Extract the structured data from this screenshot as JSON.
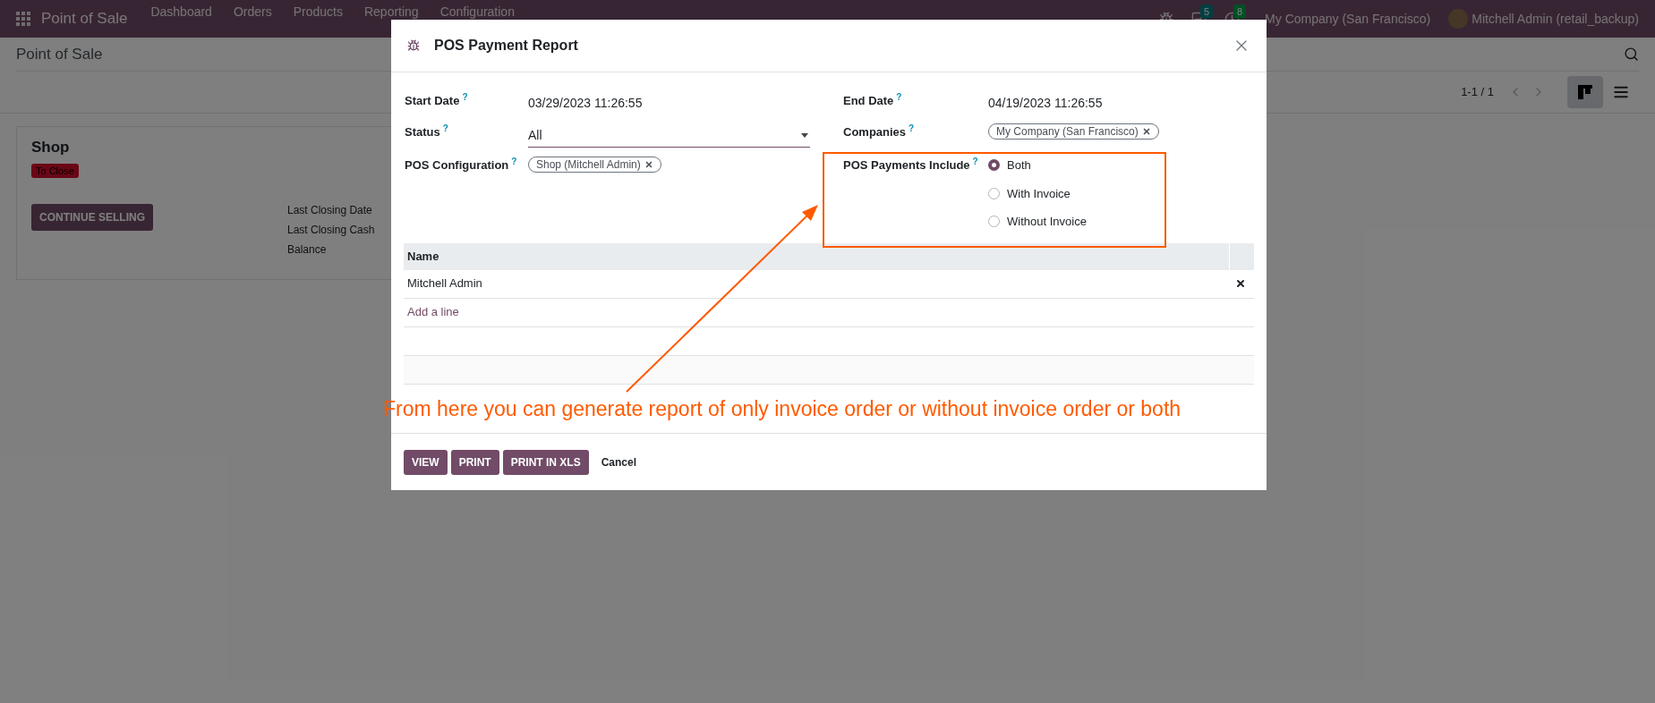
{
  "navbar": {
    "app_name": "Point of Sale",
    "menu": [
      "Dashboard",
      "Orders",
      "Products",
      "Reporting",
      "Configuration"
    ],
    "messages_badge": "5",
    "activities_badge": "8",
    "company": "My Company (San Francisco)",
    "user": "Mitchell Admin (retail_backup)"
  },
  "control_panel": {
    "breadcrumb": "Point of Sale",
    "pager": "1-1 / 1",
    "views": [
      {
        "kind": "kanban",
        "selected": true
      },
      {
        "kind": "list",
        "selected": false
      }
    ]
  },
  "card": {
    "title": "Shop",
    "badge": "To Close",
    "button": "CONTINUE SELLING",
    "info": [
      "Last Closing Date",
      "Last Closing Cash",
      "Balance"
    ]
  },
  "dialog": {
    "title": "POS Payment Report",
    "rows": [
      [
        {
          "label": "Start Date",
          "help": "?",
          "kind": "text",
          "value": "03/29/2023 11:26:55"
        },
        {
          "label": "End Date",
          "help": "?",
          "kind": "text",
          "value": "04/19/2023 11:26:55"
        }
      ],
      [
        {
          "label": "Status",
          "help": "?",
          "kind": "select",
          "value": "All"
        },
        {
          "label": "Companies",
          "help": "?",
          "kind": "tags",
          "tags": [
            "My Company (San Francisco)"
          ]
        }
      ],
      [
        {
          "label": "POS Configuration",
          "help": "?",
          "kind": "tags",
          "tags": [
            "Shop (Mitchell Admin)"
          ]
        },
        {
          "label": "POS Payments Include",
          "help": "?",
          "kind": "radio",
          "options": [
            {
              "label": "Both",
              "selected": true
            },
            {
              "label": "With Invoice",
              "selected": false
            },
            {
              "label": "Without Invoice",
              "selected": false
            }
          ]
        }
      ]
    ],
    "table": {
      "columns": [
        "Name"
      ],
      "rows": [
        {
          "name": "Mitchell Admin"
        }
      ],
      "add_line": "Add a line"
    },
    "buttons": [
      {
        "label": "VIEW",
        "kind": "primary"
      },
      {
        "label": "PRINT",
        "kind": "primary"
      },
      {
        "label": "PRINT IN XLS",
        "kind": "primary"
      },
      {
        "label": "Cancel",
        "kind": "link"
      }
    ]
  },
  "annotation": {
    "text": "From here you can generate report of only invoice order or without invoice order or both"
  }
}
